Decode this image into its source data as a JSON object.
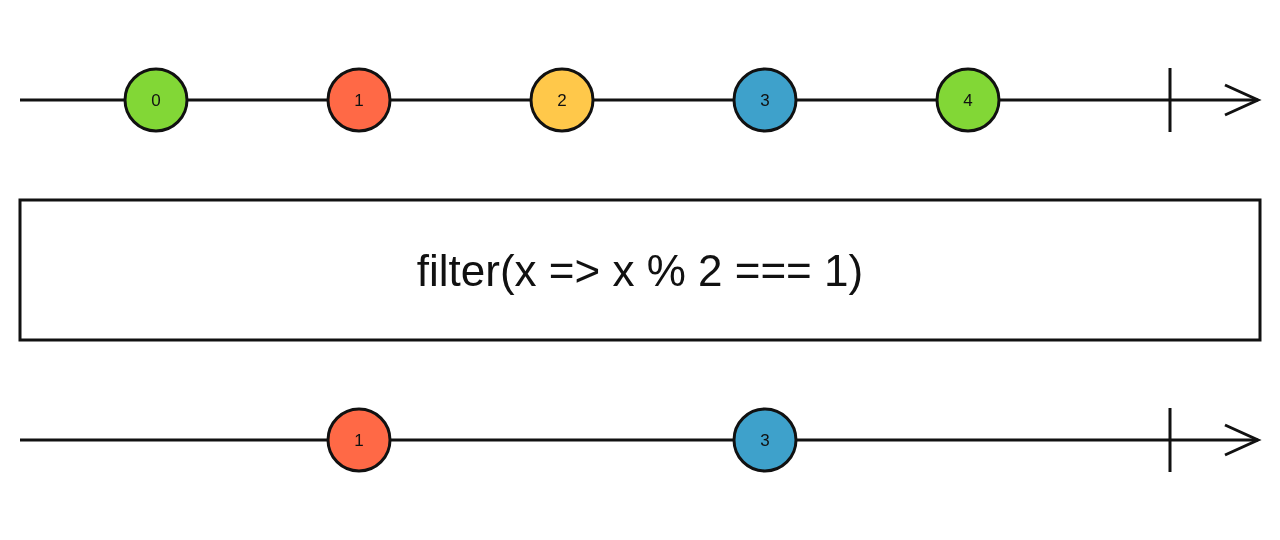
{
  "input_stream": {
    "completed": true,
    "slots": [
      {
        "kind": "marble",
        "label": "0",
        "color": "#82d736"
      },
      {
        "kind": "marble",
        "label": "1",
        "color": "#ff6946"
      },
      {
        "kind": "marble",
        "label": "2",
        "color": "#ffc84a"
      },
      {
        "kind": "marble",
        "label": "3",
        "color": "#3ea1cb"
      },
      {
        "kind": "marble",
        "label": "4",
        "color": "#82d736"
      }
    ]
  },
  "operator": {
    "label": "filter(x => x % 2 === 1)"
  },
  "output_stream": {
    "completed": true,
    "slots": [
      {
        "kind": "empty"
      },
      {
        "kind": "marble",
        "label": "1",
        "color": "#ff6946"
      },
      {
        "kind": "empty"
      },
      {
        "kind": "marble",
        "label": "3",
        "color": "#3ea1cb"
      },
      {
        "kind": "empty"
      }
    ]
  }
}
